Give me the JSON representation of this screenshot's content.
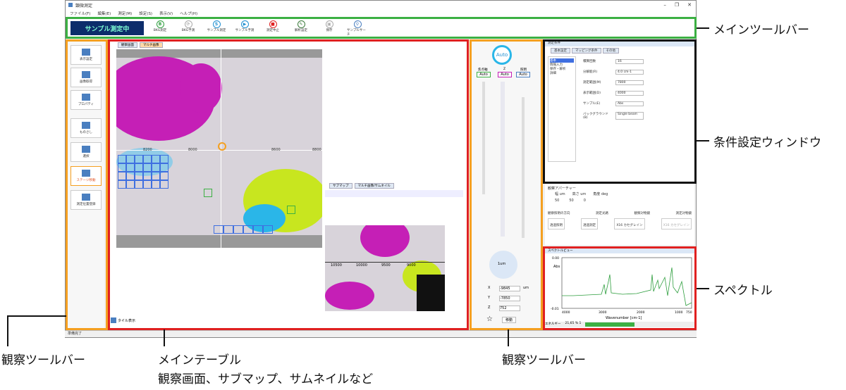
{
  "app": {
    "title": "顕微測定",
    "window_buttons": [
      "–",
      "❐",
      "✕"
    ],
    "menu": [
      "ファイル(F)",
      "編集(E)",
      "測定(M)",
      "設定(S)",
      "表示(V)",
      "ヘルプ(H)"
    ],
    "status": "準備完了"
  },
  "toolbar": {
    "measure_label": "サンプル測定中",
    "items": [
      {
        "glyph": "B",
        "label": "BKG測定",
        "color": "#2e9e3e"
      },
      {
        "glyph": "⟳",
        "label": "BKG予測",
        "color": "#aaaaaa"
      },
      {
        "glyph": "S",
        "label": "サンプル測定",
        "color": "#1f8fd1"
      },
      {
        "glyph": "▶",
        "label": "サンプル予測",
        "color": "#1f8fd1"
      },
      {
        "glyph": "■",
        "label": "測定中止",
        "color": "#e02020"
      },
      {
        "glyph": "✎",
        "label": "解析設定",
        "color": "#3a7a3a"
      },
      {
        "glyph": "▣",
        "label": "保存",
        "color": "#aaaaaa"
      },
      {
        "glyph": "⚲",
        "label": "サンプルサーチ",
        "color": "#4a7fc0"
      }
    ]
  },
  "left_panel": {
    "buttons": [
      "表示設定",
      "画像取得",
      "プロパティ",
      "ものさし",
      "選択",
      "ステージ移動",
      "測定位置登録"
    ]
  },
  "main": {
    "tabs": [
      "観察画面",
      "マルチ画像"
    ],
    "ticks_x": [
      "8200",
      "8000",
      "8600",
      "8800"
    ],
    "bottom_button": "タイル表示",
    "submap_tabs": [
      "サブマップ",
      "マルチ画像/サムネイル"
    ],
    "submap_ticks": [
      "10500",
      "10000",
      "9500",
      "9000"
    ]
  },
  "right_toolbar": {
    "auto_label": "Auto",
    "columns": [
      "焦点軸",
      "Z",
      "照明"
    ],
    "values": [
      "Auto",
      "Auto",
      "Auto"
    ],
    "xyz_labels": [
      "X",
      "Y",
      "Z"
    ],
    "xyz_values": [
      "-9845",
      "-7850",
      "752"
    ],
    "unit": "um",
    "move_label": "移動",
    "step_label": "1um"
  },
  "conditions": {
    "title": "測定条件",
    "tabs": [
      "基本設定",
      "マッピング条件",
      "その他"
    ],
    "tree": [
      "基本",
      "情報入力",
      "保存・解析",
      "詳細"
    ],
    "fields": [
      {
        "label": "積算回数",
        "value": "16"
      },
      {
        "label": "分解能(R)",
        "value": "4.0 cm-1"
      },
      {
        "label": "測定範囲(M)",
        "value": "7800"
      },
      {
        "label": "表示範囲(D)",
        "value": "4000"
      },
      {
        "label": "サンプル(E)",
        "value": "Abs"
      },
      {
        "label": "バックグラウンド(B)",
        "value": "Single beam"
      }
    ],
    "aperture_title": "観察アパーチャー",
    "aperture_headers": [
      "幅 um",
      "高さ um",
      "角度 deg"
    ],
    "aperture_values": [
      "50",
      "50",
      "0"
    ],
    "obs_headers": [
      "観察照明の方向",
      "測定光路",
      "観察対物鏡",
      "測定対物鏡"
    ],
    "obs_labels": [
      "透過照明",
      "透過測定",
      "X16 カセグレイン",
      "X16 カセグレイン"
    ]
  },
  "spectrum": {
    "title": "スペクトルビュー",
    "ylabel": "Abs",
    "xlabel": "Wavenumber [cm-1]",
    "yticks": [
      "0.00",
      "-0.01"
    ],
    "xticks": [
      "4000",
      "3000",
      "2000",
      "1000",
      "750"
    ],
    "footer": [
      "エネルギー",
      "21,65 % 1"
    ]
  },
  "callouts": {
    "main_toolbar": "メインツールバー",
    "conditions": "条件設定ウィンドウ",
    "spectrum": "スペクトル",
    "obs_left": "観察ツールバー",
    "main_table": "メインテーブル",
    "main_table_sub": "観察画面、サブマップ、サムネイルなど",
    "obs_right": "観察ツールバー"
  },
  "colors": {
    "green": "#3cb043",
    "orange": "#f5a020",
    "red": "#e02020",
    "black": "#111111"
  }
}
